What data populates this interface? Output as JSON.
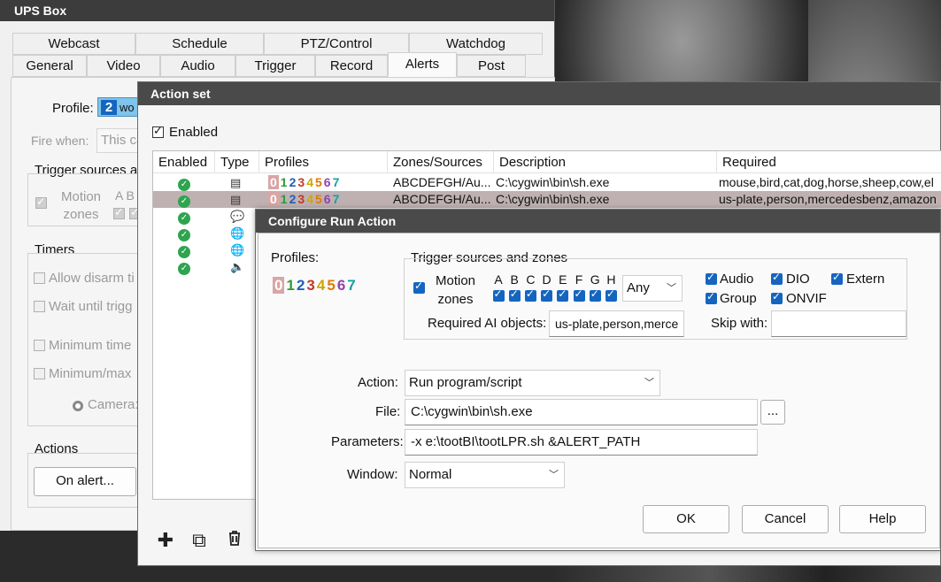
{
  "ups_box": {
    "title": "UPS Box",
    "tabs_top": [
      "Webcast",
      "Schedule",
      "PTZ/Control",
      "Watchdog"
    ],
    "tabs_bottom": [
      "General",
      "Video",
      "Audio",
      "Trigger",
      "Record",
      "Alerts",
      "Post"
    ],
    "active_tab": "Alerts",
    "profile_label": "Profile:",
    "profile_value_num": "2",
    "profile_value_text": "wo",
    "fire_when_label": "Fire when:",
    "fire_when_value": "This ca",
    "trigger_sources_label": "Trigger sources an",
    "motion_zones_label": "Motion zones",
    "motion_zone_letters": "A B",
    "timers_label": "Timers",
    "allow_disarm": "Allow disarm ti",
    "wait_until": "Wait until trigg",
    "minimum_time": "Minimum time",
    "minimum_max": "Minimum/max",
    "camera_label": "Camera:",
    "actions_label": "Actions",
    "on_alert_button": "On alert..."
  },
  "action_set": {
    "title": "Action set",
    "enabled_label": "Enabled",
    "columns": [
      "Enabled",
      "Type",
      "Profiles",
      "Zones/Sources",
      "Description",
      "Required"
    ],
    "profile_digits": [
      "0",
      "1",
      "2",
      "3",
      "4",
      "5",
      "6",
      "7"
    ],
    "rows": [
      {
        "type_icon": "document-icon",
        "zones": "ABCDEFGH/Au...",
        "description": "C:\\cygwin\\bin\\sh.exe",
        "required": "mouse,bird,cat,dog,horse,sheep,cow,el",
        "selected": false
      },
      {
        "type_icon": "document-icon",
        "zones": "ABCDEFGH/Au...",
        "description": "C:\\cygwin\\bin\\sh.exe",
        "required": "us-plate,person,mercedesbenz,amazon",
        "selected": true
      },
      {
        "type_icon": "chat-icon",
        "zones": "",
        "description": "",
        "required": "",
        "selected": false
      },
      {
        "type_icon": "globe-icon",
        "zones": "",
        "description": "",
        "required": "",
        "selected": false
      },
      {
        "type_icon": "globe-icon",
        "zones": "",
        "description": "",
        "required": "",
        "selected": false
      },
      {
        "type_icon": "speaker-icon",
        "zones": "",
        "description": "",
        "required": "",
        "selected": false
      }
    ]
  },
  "configure": {
    "title": "Configure Run Action",
    "profiles_label": "Profiles:",
    "profile_digits": [
      "0",
      "1",
      "2",
      "3",
      "4",
      "5",
      "6",
      "7"
    ],
    "trigger_group_label": "Trigger sources and zones",
    "motion_zones_label": "Motion zones",
    "zone_letters": [
      "A",
      "B",
      "C",
      "D",
      "E",
      "F",
      "G",
      "H"
    ],
    "any_value": "Any",
    "audio_label": "Audio",
    "dio_label": "DIO",
    "extern_label": "Extern",
    "group_label": "Group",
    "onvif_label": "ONVIF",
    "required_ai_label": "Required AI objects:",
    "required_ai_value": "us-plate,person,merce",
    "skip_with_label": "Skip with:",
    "skip_with_value": "",
    "action_label": "Action:",
    "action_value": "Run program/script",
    "file_label": "File:",
    "file_value": "C:\\cygwin\\bin\\sh.exe",
    "browse_label": "...",
    "parameters_label": "Parameters:",
    "parameters_value": "-x e:\\tootBI\\tootLPR.sh &ALERT_PATH",
    "window_label": "Window:",
    "window_value": "Normal",
    "ok_label": "OK",
    "cancel_label": "Cancel",
    "help_label": "Help"
  },
  "colors": {
    "accent": "#1565c0",
    "selected_row": "#bfb1b1",
    "enabled_green": "#2ea44f",
    "profile_colors": [
      "#d9a5a5",
      "#2e9a3c",
      "#1f5fbf",
      "#c0392b",
      "#c9a800",
      "#e07b00",
      "#8e44ad",
      "#16a0a0"
    ]
  }
}
